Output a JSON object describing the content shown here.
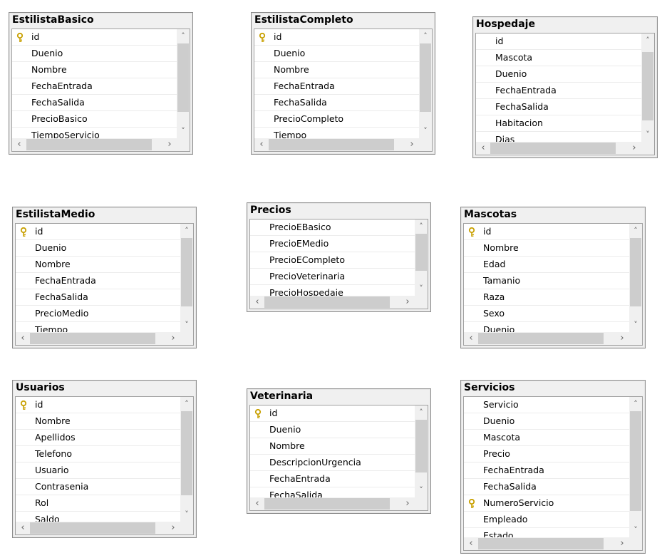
{
  "tables": [
    {
      "name": "EstilistaBasico",
      "key_field": "id",
      "fields": [
        "id",
        "Duenio",
        "Nombre",
        "FechaEntrada",
        "FechaSalida",
        "PrecioBasico",
        "TiempoServicio"
      ]
    },
    {
      "name": "EstilistaCompleto",
      "key_field": "id",
      "fields": [
        "id",
        "Duenio",
        "Nombre",
        "FechaEntrada",
        "FechaSalida",
        "PrecioCompleto",
        "Tiempo"
      ]
    },
    {
      "name": "Hospedaje",
      "key_field": "",
      "fields": [
        "id",
        "Mascota",
        "Duenio",
        "FechaEntrada",
        "FechaSalida",
        "Habitacion",
        "Dias"
      ]
    },
    {
      "name": "EstilistaMedio",
      "key_field": "id",
      "fields": [
        "id",
        "Duenio",
        "Nombre",
        "FechaEntrada",
        "FechaSalida",
        "PrecioMedio",
        "Tiempo"
      ]
    },
    {
      "name": "Precios",
      "key_field": "",
      "fields": [
        "PrecioEBasico",
        "PrecioEMedio",
        "PrecioECompleto",
        "PrecioVeterinaria",
        "PrecioHospedaje"
      ]
    },
    {
      "name": "Mascotas",
      "key_field": "id",
      "fields": [
        "id",
        "Nombre",
        "Edad",
        "Tamanio",
        "Raza",
        "Sexo",
        "Duenio"
      ]
    },
    {
      "name": "Usuarios",
      "key_field": "id",
      "fields": [
        "id",
        "Nombre",
        "Apellidos",
        "Telefono",
        "Usuario",
        "Contrasenia",
        "Rol",
        "Saldo"
      ]
    },
    {
      "name": "Veterinaria",
      "key_field": "id",
      "fields": [
        "id",
        "Duenio",
        "Nombre",
        "DescripcionUrgencia",
        "FechaEntrada",
        "FechaSalida"
      ]
    },
    {
      "name": "Servicios",
      "key_field": "NumeroServicio",
      "fields": [
        "Servicio",
        "Duenio",
        "Mascota",
        "Precio",
        "FechaEntrada",
        "FechaSalida",
        "NumeroServicio",
        "Empleado",
        "Estado"
      ]
    }
  ],
  "icons": {
    "key": "key-icon",
    "scroll_up": "chevron-up-icon",
    "scroll_down": "chevron-down-icon",
    "scroll_left": "chevron-left-icon",
    "scroll_right": "chevron-right-icon"
  },
  "colors": {
    "key_icon": "#c8a000",
    "scroll_thumb": "#cdcdcd",
    "panel_bg": "#f0f0f0"
  }
}
